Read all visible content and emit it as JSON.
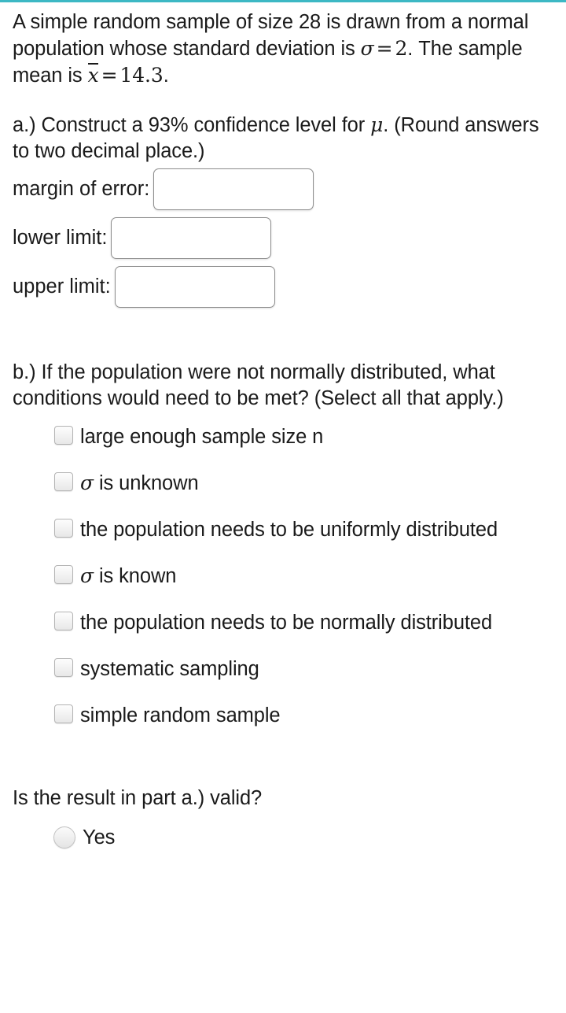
{
  "theme": {
    "accent_color": "#3cb8c4",
    "background_color": "#ffffff",
    "text_color": "#1a1a1a",
    "input_border_color": "#8d8d8d",
    "control_fill_color": "#e8e8e8"
  },
  "problem": {
    "line1_part1": "A simple random sample of size 28 is drawn from a normal population whose standard deviation is ",
    "sigma_symbol": "σ",
    "equals": "=",
    "sigma_value": "2",
    "line1_part2": ".",
    "line2_part1": "The sample mean is ",
    "xbar_symbol": "x",
    "xbar_value": "14.3",
    "line2_part2": "."
  },
  "part_a": {
    "text_before_mu": "a.) Construct a 93% confidence level for ",
    "mu_symbol": "μ",
    "text_after_mu": ". (Round answers to two decimal place.)",
    "confidence_level": "93%",
    "fields": [
      {
        "label": "margin of error:",
        "value": "",
        "placeholder": ""
      },
      {
        "label": "lower limit:",
        "value": "",
        "placeholder": ""
      },
      {
        "label": "upper limit:",
        "value": "",
        "placeholder": ""
      }
    ]
  },
  "part_b": {
    "question": "b.) If the population were not normally distributed, what conditions would need to be met? (Select all that apply.)",
    "options": [
      {
        "label": "large enough sample size n",
        "checked": false
      },
      {
        "label": "σ is unknown",
        "checked": false,
        "math_prefix": "σ",
        "math_rest": " is unknown"
      },
      {
        "label": "the population needs to be uniformly distributed",
        "checked": false
      },
      {
        "label": "σ is known",
        "checked": false,
        "math_prefix": "σ",
        "math_rest": " is known"
      },
      {
        "label": "the population needs to be normally distributed",
        "checked": false
      },
      {
        "label": "systematic sampling",
        "checked": false
      },
      {
        "label": "simple random sample",
        "checked": false
      }
    ]
  },
  "part_c": {
    "question": "Is the result in part a.) valid?",
    "options": [
      {
        "label": "Yes",
        "selected": false
      }
    ]
  }
}
